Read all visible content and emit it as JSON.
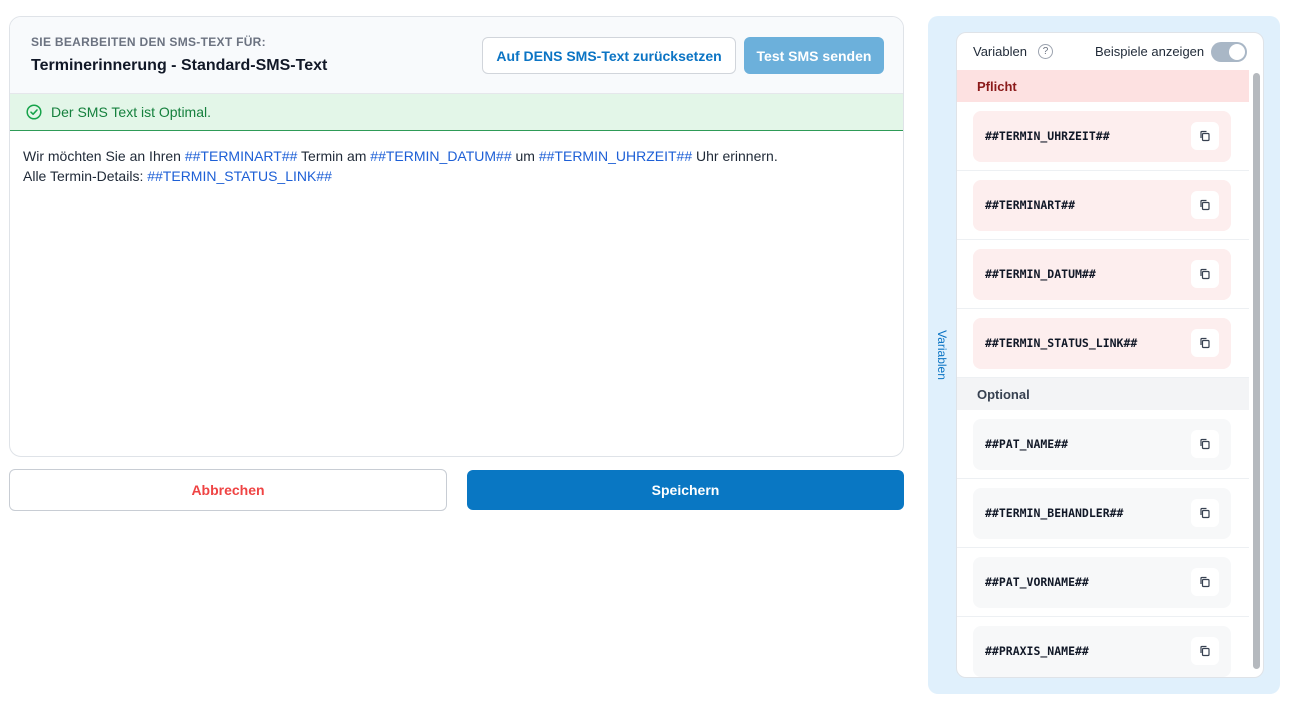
{
  "editor": {
    "kicker": "SIE BEARBEITEN DEN SMS-TEXT FÜR:",
    "title": "Terminerinnerung - Standard-SMS-Text",
    "reset_button": "Auf DENS SMS-Text zurücksetzen",
    "test_button": "Test SMS senden",
    "status": "Der SMS Text ist Optimal.",
    "line1": [
      {
        "t": "Wir möchten Sie an Ihren ",
        "var": false
      },
      {
        "t": "##TERMINART##",
        "var": true
      },
      {
        "t": " Termin am ",
        "var": false
      },
      {
        "t": "##TERMIN_DATUM##",
        "var": true
      },
      {
        "t": " um ",
        "var": false
      },
      {
        "t": "##TERMIN_UHRZEIT##",
        "var": true
      },
      {
        "t": " Uhr erinnern.",
        "var": false
      }
    ],
    "line2": [
      {
        "t": "Alle Termin-Details: ",
        "var": false
      },
      {
        "t": "##TERMIN_STATUS_LINK##",
        "var": true
      }
    ]
  },
  "actions": {
    "cancel": "Abbrechen",
    "save": "Speichern"
  },
  "panel": {
    "tab_label": "Variablen",
    "header_label": "Variablen",
    "examples_label": "Beispiele anzeigen",
    "examples_enabled": false,
    "required_label": "Pflicht",
    "optional_label": "Optional",
    "required_vars": [
      "##TERMIN_UHRZEIT##",
      "##TERMINART##",
      "##TERMIN_DATUM##",
      "##TERMIN_STATUS_LINK##"
    ],
    "optional_vars": [
      "##PAT_NAME##",
      "##TERMIN_BEHANDLER##",
      "##PAT_VORNAME##",
      "##PRAXIS_NAME##"
    ]
  },
  "colors": {
    "primary": "#0977c3",
    "link": "#1d5fd6",
    "success": "#15803d",
    "danger": "#ef4444"
  }
}
